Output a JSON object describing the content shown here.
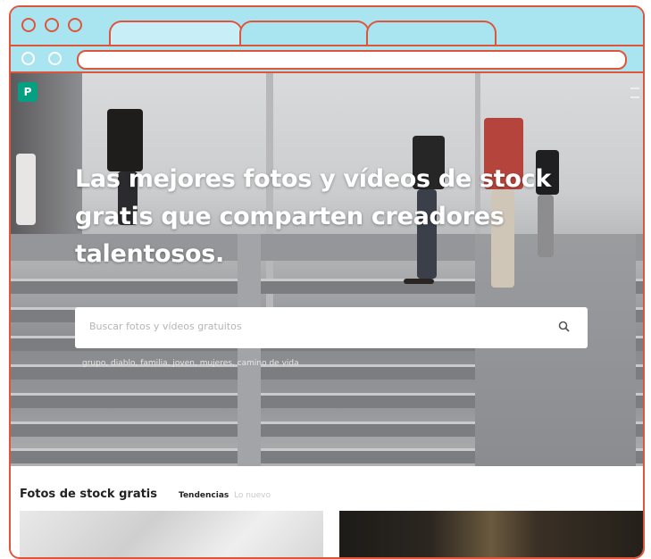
{
  "browser": {
    "window_controls": [
      "close-dot",
      "minimize-dot",
      "maximize-dot"
    ],
    "tabs_count": 3,
    "accent": "#e0553a",
    "chrome_color": "#a9e4f1",
    "url": ""
  },
  "site": {
    "logo_letter": "P",
    "logo_color": "#05a081",
    "headline": "Las mejores fotos y vídeos de stock gratis que comparten creadores talentosos.",
    "search": {
      "placeholder": "Buscar fotos y vídeos gratuitos"
    },
    "suggested_tags": "grupo, diablo, familia, joven, mujeres, camino de vida",
    "section": {
      "title": "Fotos de stock gratis",
      "tab_trending": "Tendencias",
      "tab_new": "Lo nuevo"
    }
  }
}
